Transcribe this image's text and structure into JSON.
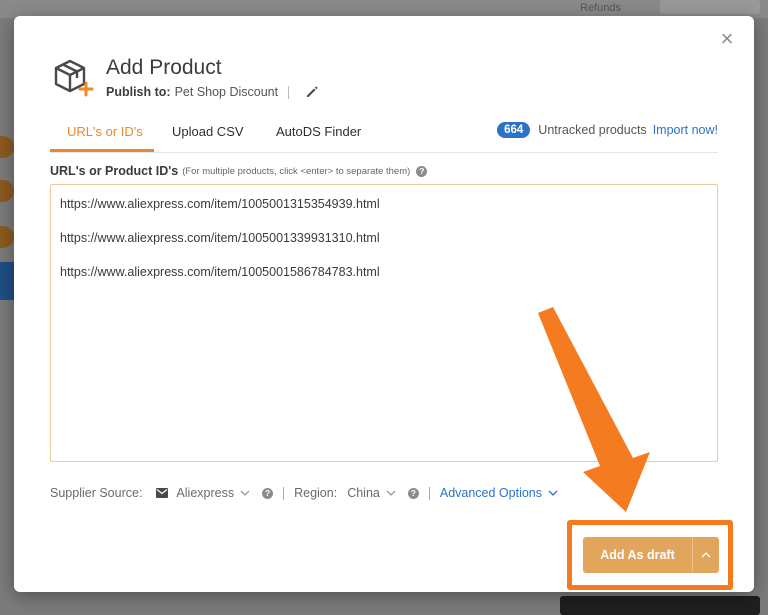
{
  "background": {
    "topbar_text": "Refunds"
  },
  "modal": {
    "title": "Add Product",
    "publish_label": "Publish to:",
    "publish_value": "Pet Shop Discount",
    "close_glyph": "×"
  },
  "tabs": [
    {
      "label": "URL's or ID's",
      "active": true
    },
    {
      "label": "Upload CSV",
      "active": false
    },
    {
      "label": "AutoDS Finder",
      "active": false
    }
  ],
  "untracked": {
    "count": "664",
    "label": "Untracked products",
    "link": "Import now!"
  },
  "field": {
    "label": "URL's or Product ID's",
    "hint": "(For multiple products, click <enter> to separate them)"
  },
  "urls": [
    "https://www.aliexpress.com/item/1005001315354939.html",
    "https://www.aliexpress.com/item/1005001339931310.html",
    "https://www.aliexpress.com/item/1005001586784783.html"
  ],
  "supplier": {
    "label": "Supplier Source:",
    "value": "Aliexpress",
    "region_label": "Region:",
    "region_value": "China",
    "advanced": "Advanced Options"
  },
  "footer": {
    "primary_button": "Add As draft"
  },
  "colors": {
    "accent_orange": "#e8882e",
    "button_orange": "#e2a55c",
    "highlight_orange": "#f47b20",
    "link_blue": "#2b73c8"
  },
  "icons": {
    "product": "box-plus-icon",
    "edit": "pencil-icon",
    "help": "question-circle-icon",
    "mail": "envelope-icon",
    "chevron": "chevron-down-icon",
    "close": "close-icon"
  }
}
